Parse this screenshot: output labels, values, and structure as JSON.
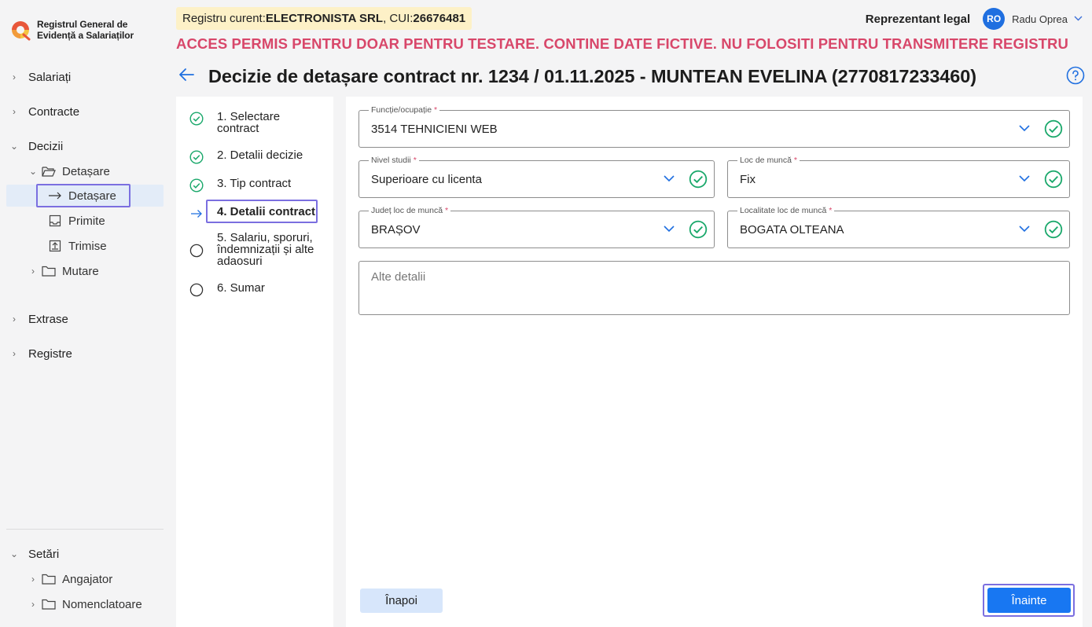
{
  "app": {
    "title_line1": "Registrul General de",
    "title_line2": "Evidență a Salariaților"
  },
  "sidebar": {
    "salariati": "Salariați",
    "contracte": "Contracte",
    "decizii": "Decizii",
    "detasare_folder": "Detașare",
    "detasare_active": "Detașare",
    "primite": "Primite",
    "trimise": "Trimise",
    "mutare": "Mutare",
    "extrase": "Extrase",
    "registre": "Registre",
    "setari": "Setări",
    "angajator": "Angajator",
    "nomenclatoare": "Nomenclatoare"
  },
  "header": {
    "registry_prefix": "Registru curent: ",
    "company": "ELECTRONISTA SRL",
    "cui_prefix": ", CUI: ",
    "cui": "26676481",
    "warning": "ACCES PERMIS PENTRU DOAR PENTRU TESTARE. CONTINE DATE FICTIVE. NU FOLOSITI PENTRU TRANSMITERE REGISTRU",
    "role": "Reprezentant legal",
    "avatar_initials": "RO",
    "user_name": "Radu Oprea"
  },
  "page": {
    "title": "Decizie de detașare contract nr. 1234 / 01.11.2025 - MUNTEAN EVELINA (2770817233460)"
  },
  "steps": [
    {
      "label": "1. Selectare contract",
      "state": "done"
    },
    {
      "label": "2. Detalii decizie",
      "state": "done"
    },
    {
      "label": "3. Tip contract",
      "state": "done"
    },
    {
      "label": "4. Detalii contract",
      "state": "current"
    },
    {
      "label": "5. Salariu, sporuri, îndemnizații și alte adaosuri",
      "state": "todo"
    },
    {
      "label": "6. Sumar",
      "state": "todo"
    }
  ],
  "form": {
    "functie": {
      "label": "Funcție/ocupație",
      "required": "*",
      "value": "3514 TEHNICIENI WEB"
    },
    "nivel_studii": {
      "label": "Nivel studii",
      "required": "*",
      "value": "Superioare cu licenta"
    },
    "loc_munca": {
      "label": "Loc de muncă",
      "required": "*",
      "value": "Fix"
    },
    "judet": {
      "label": "Județ loc de muncă",
      "required": "*",
      "value": "BRAȘOV"
    },
    "localitate": {
      "label": "Localitate loc de muncă",
      "required": "*",
      "value": "BOGATA OLTEANA"
    },
    "alte_detalii": {
      "placeholder": "Alte detalii"
    }
  },
  "buttons": {
    "back": "Înapoi",
    "next": "Înainte"
  },
  "colors": {
    "accent": "#1877f2",
    "check": "#1aa86b",
    "warning": "#d8476a",
    "focus_outline": "#7b6fe0"
  }
}
